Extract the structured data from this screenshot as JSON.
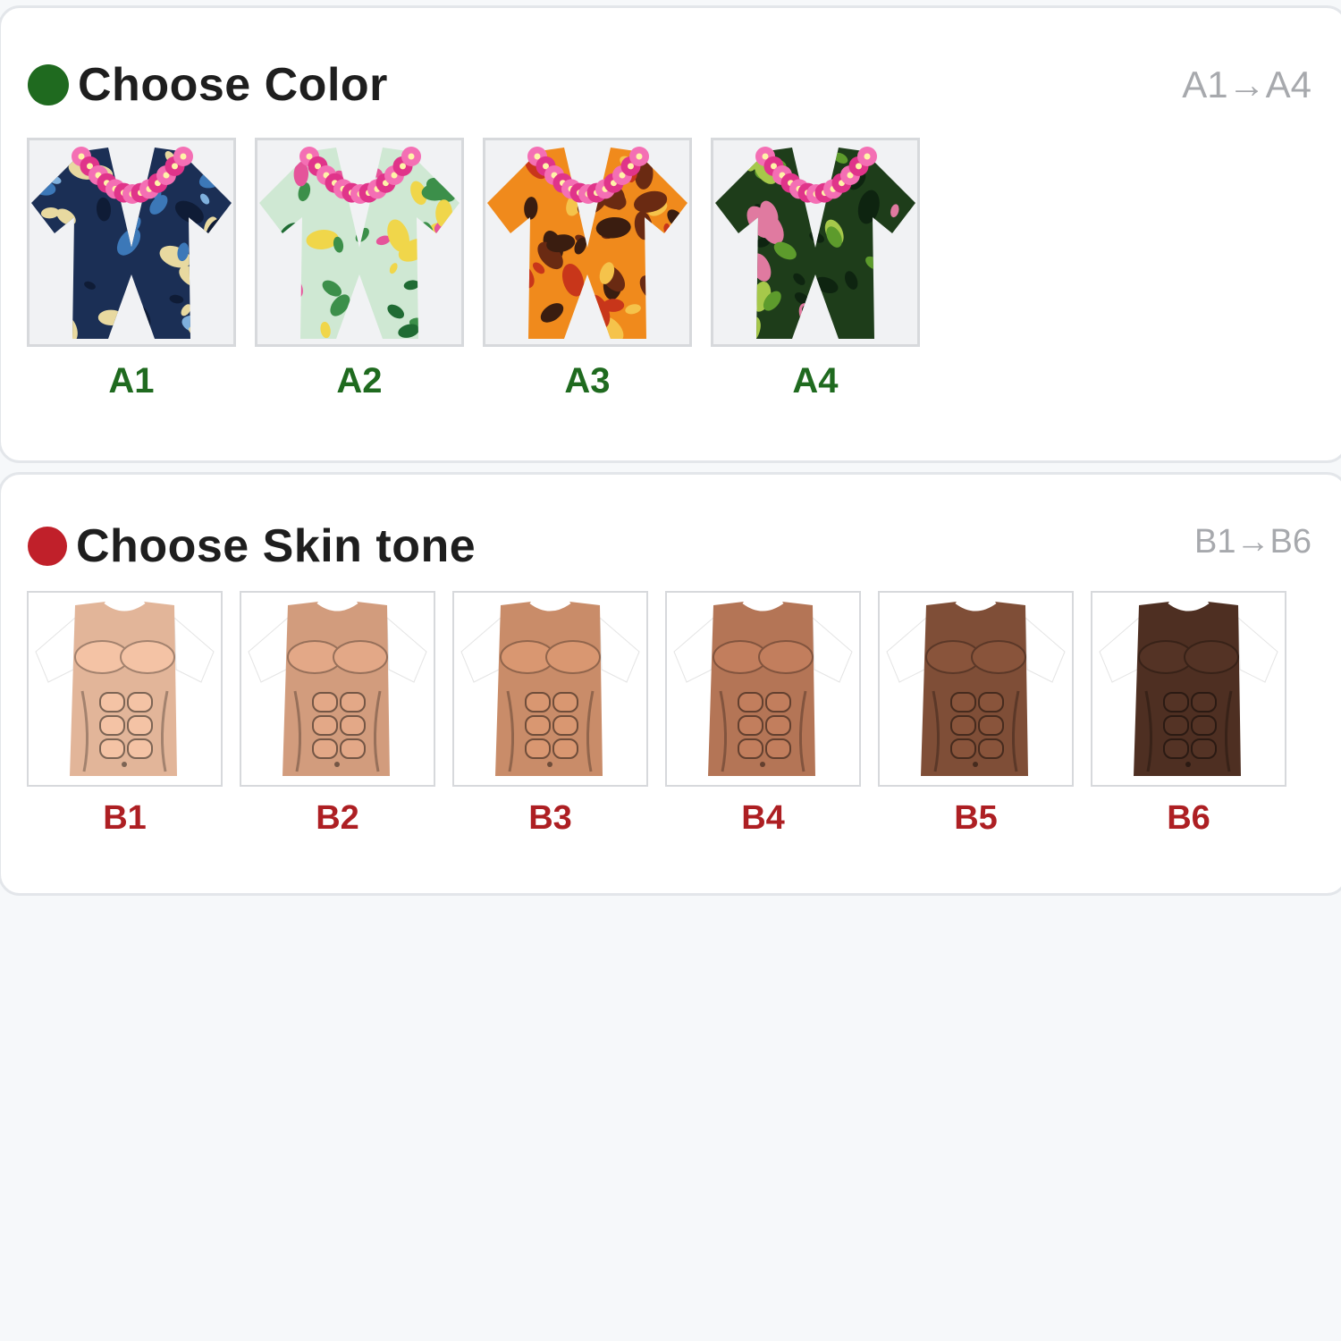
{
  "colors": {
    "accent_green": "#1f6a1f",
    "accent_red": "#c0202a",
    "label_red": "#ad1f23",
    "range_gray": "#a7a9ad",
    "page_bg": "#f6f8fa"
  },
  "color_section": {
    "title": "Choose Color",
    "range": "A1→A4",
    "dot_icon": "green-dot-icon",
    "options": [
      {
        "label": "A1",
        "pattern": "navy-blue floral hawaiian shirt with pink lei"
      },
      {
        "label": "A2",
        "pattern": "mint green tropical leaf hawaiian shirt with pink lei"
      },
      {
        "label": "A3",
        "pattern": "orange sunset palm hawaiian shirt with pink lei"
      },
      {
        "label": "A4",
        "pattern": "dark green jungle hawaiian shirt with pink lei"
      }
    ]
  },
  "skin_section": {
    "title": "Choose Skin tone",
    "range": "B1→B6",
    "dot_icon": "red-dot-icon",
    "options": [
      {
        "label": "B1",
        "tone": "#e2b599"
      },
      {
        "label": "B2",
        "tone": "#d29c7d"
      },
      {
        "label": "B3",
        "tone": "#c98c69"
      },
      {
        "label": "B4",
        "tone": "#b47556"
      },
      {
        "label": "B5",
        "tone": "#7f4e37"
      },
      {
        "label": "B6",
        "tone": "#4e2f22"
      }
    ]
  }
}
